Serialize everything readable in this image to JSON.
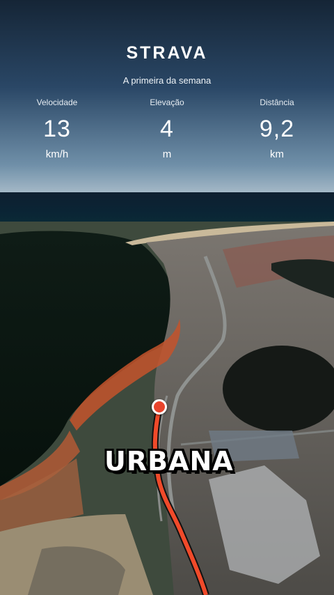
{
  "header": {
    "brand": "STRAVA",
    "subtitle": "A primeira da semana"
  },
  "stats": [
    {
      "label": "Velocidade",
      "value": "13",
      "unit": "km/h"
    },
    {
      "label": "Elevação",
      "value": "4",
      "unit": "m"
    },
    {
      "label": "Distância",
      "value": "9,2",
      "unit": "km"
    }
  ],
  "overlay": {
    "tag": "URBANA"
  },
  "colors": {
    "route": "#f04a2a",
    "marker": "#e8442c",
    "text": "#ffffff"
  }
}
